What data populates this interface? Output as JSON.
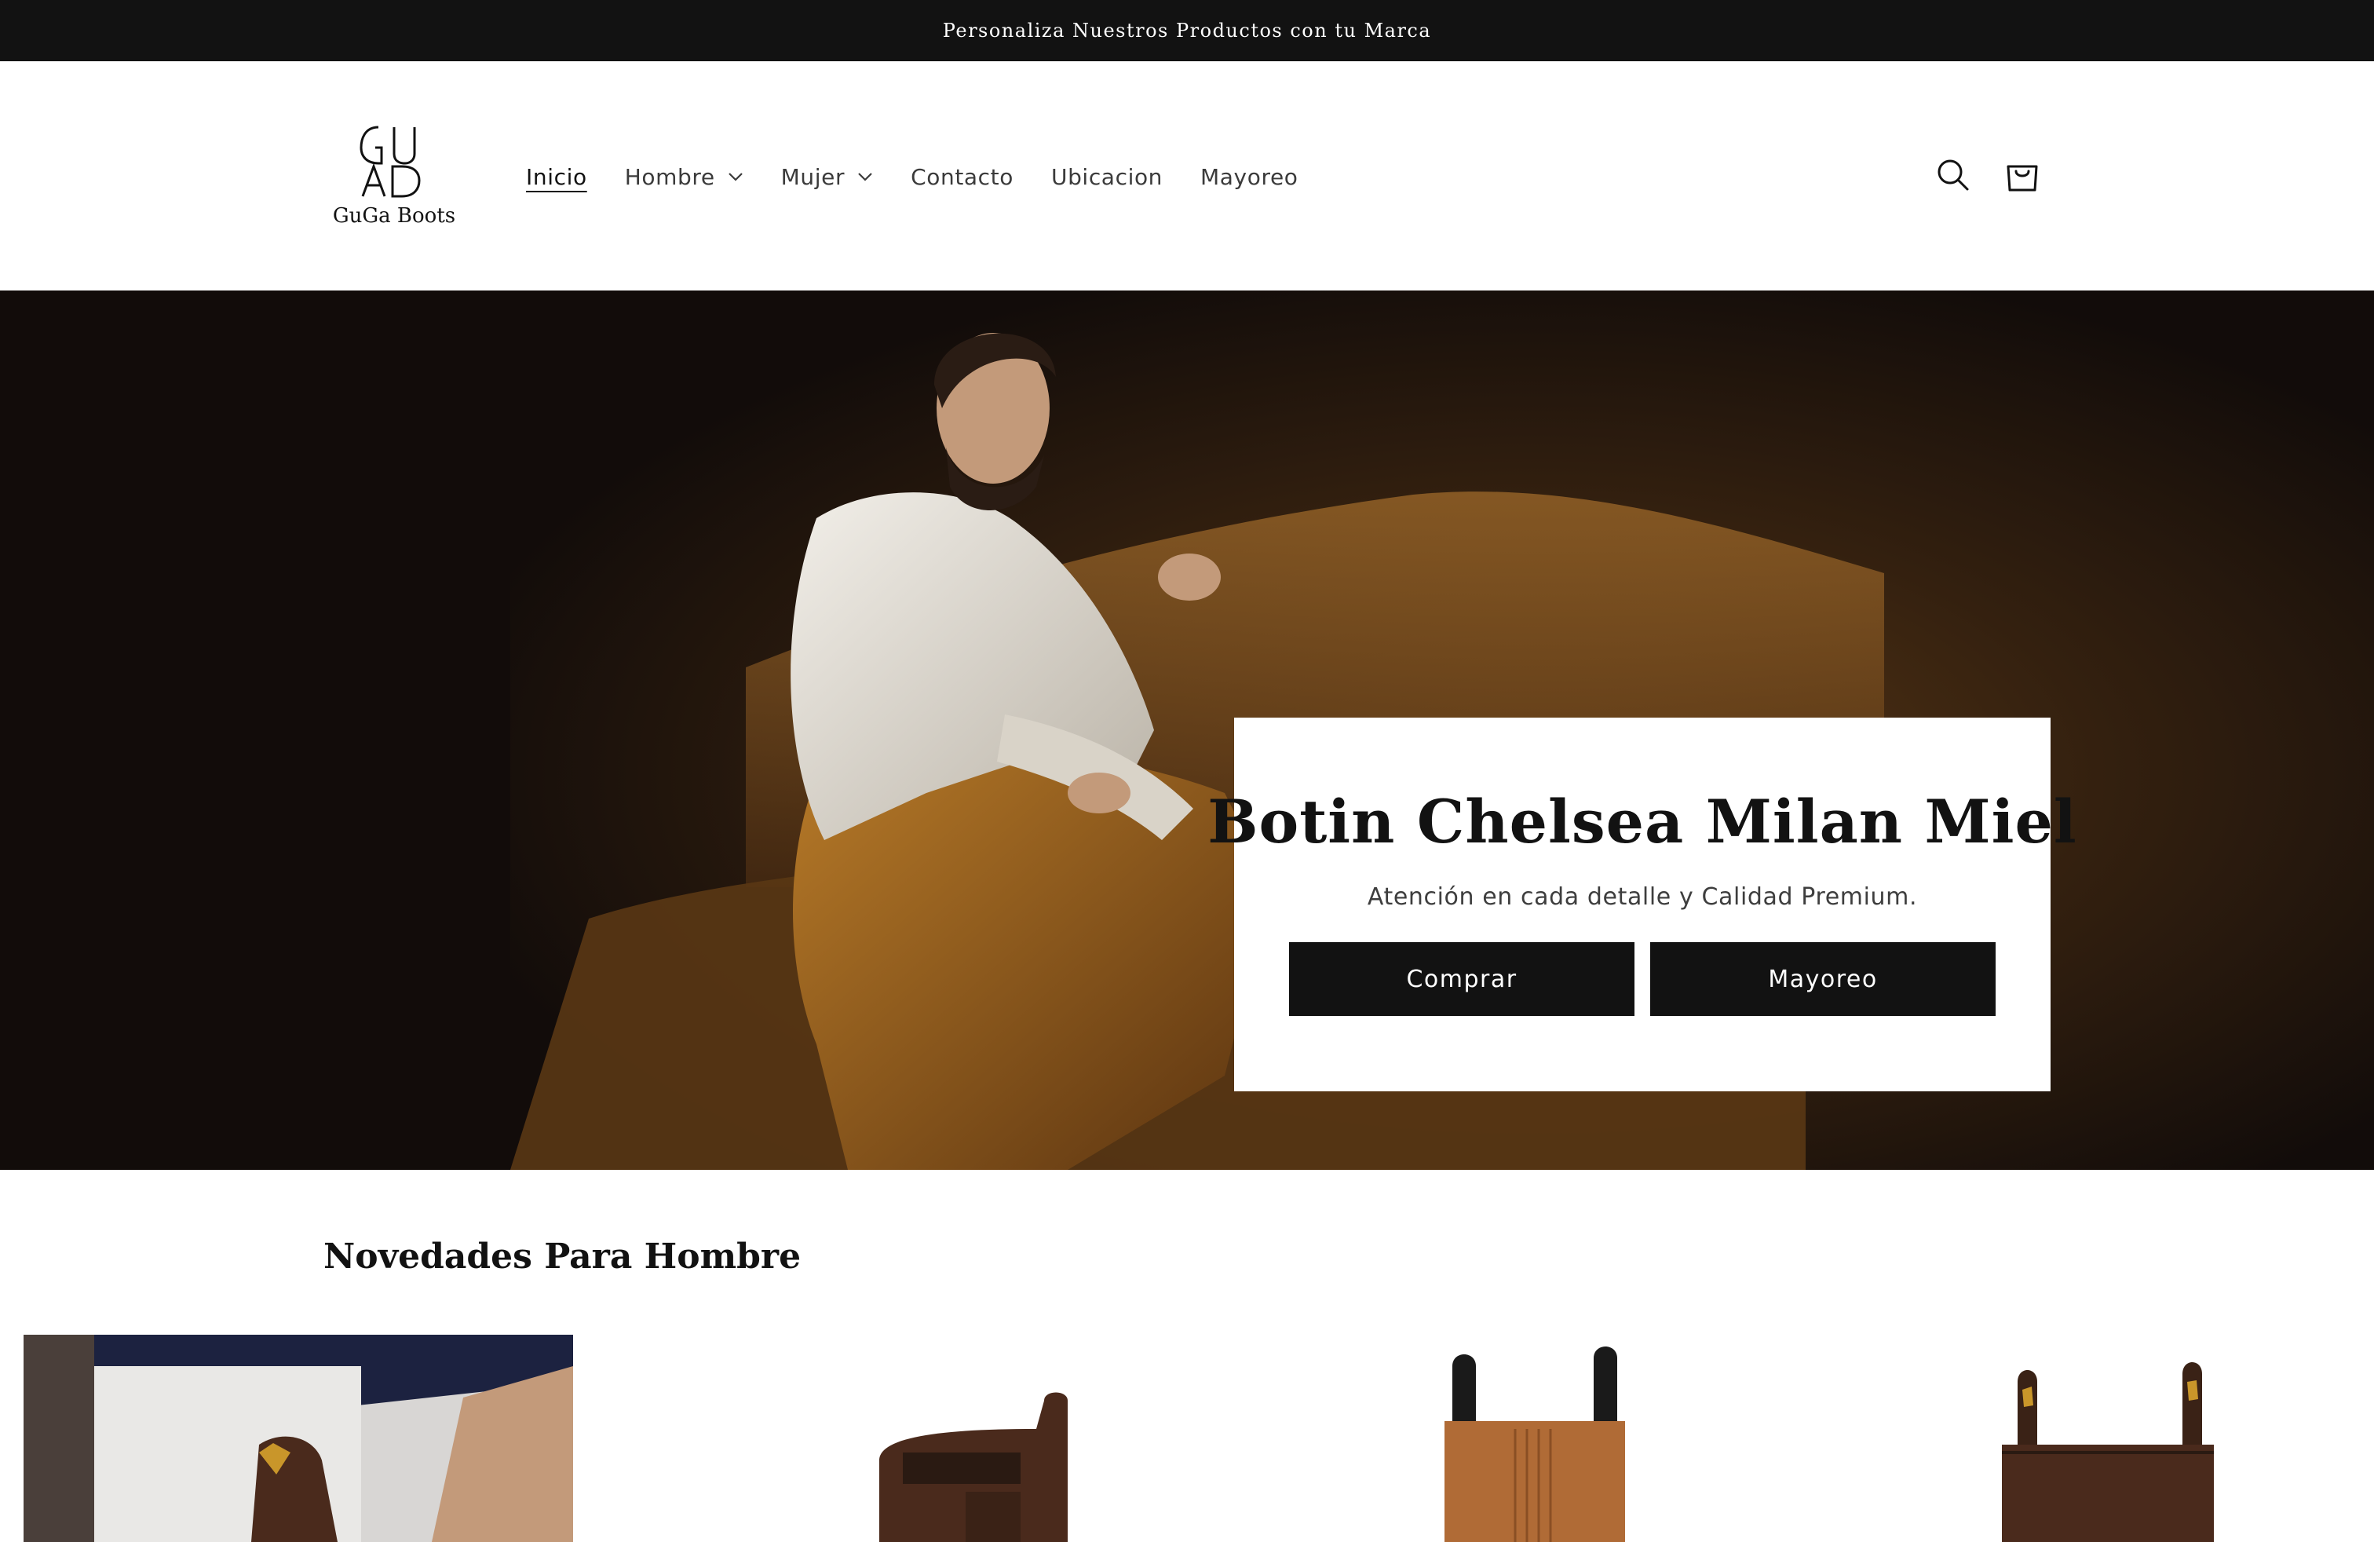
{
  "announcement": {
    "text": "Personaliza Nuestros Productos con tu Marca"
  },
  "header": {
    "logo_text": "GuGa Boots",
    "nav": [
      {
        "label": "Inicio",
        "active": true,
        "dropdown": false
      },
      {
        "label": "Hombre",
        "active": false,
        "dropdown": true
      },
      {
        "label": "Mujer",
        "active": false,
        "dropdown": true
      },
      {
        "label": "Contacto",
        "active": false,
        "dropdown": false
      },
      {
        "label": "Ubicacion",
        "active": false,
        "dropdown": false
      },
      {
        "label": "Mayoreo",
        "active": false,
        "dropdown": false
      }
    ],
    "icons": {
      "search": "search-icon",
      "cart": "cart-icon"
    }
  },
  "hero": {
    "title": "Botin Chelsea Milan Miel",
    "subtitle": "Atención en cada detalle y Calidad Premium.",
    "buttons": {
      "primary": "Comprar",
      "secondary": "Mayoreo"
    }
  },
  "section": {
    "title": "Novedades Para Hombre"
  },
  "colors": {
    "dark": "#121212",
    "hero_bg": "#120c0a",
    "white": "#ffffff"
  }
}
